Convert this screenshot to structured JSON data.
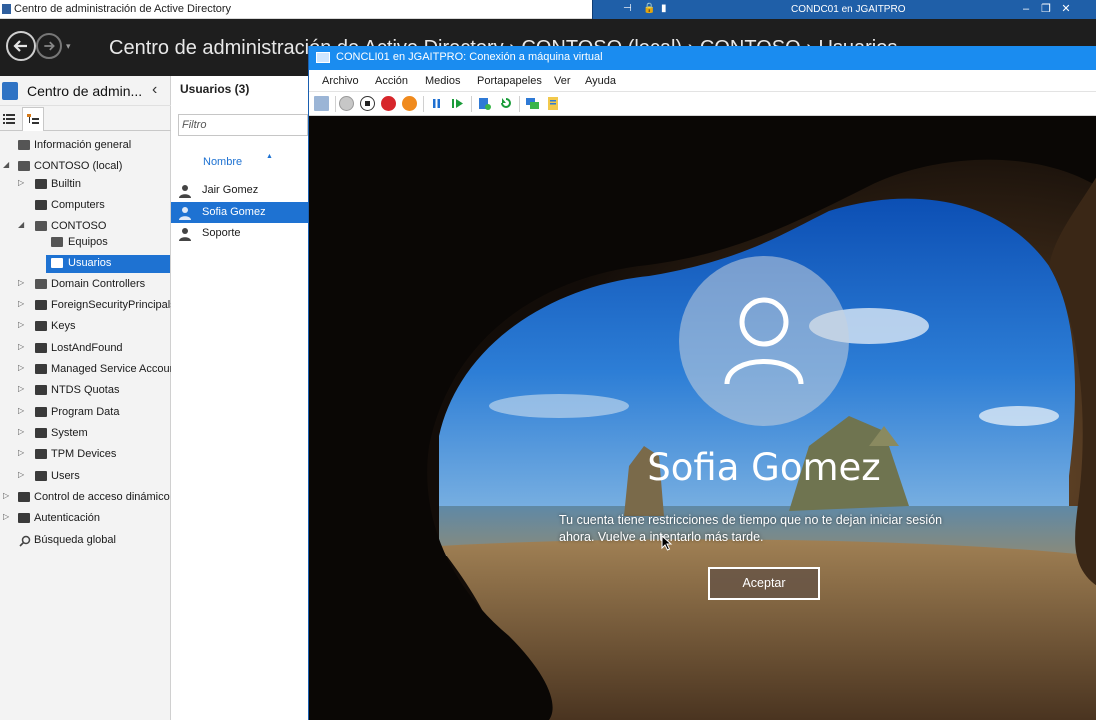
{
  "window": {
    "title": "Centro de administración de Active Directory"
  },
  "remote_bar": {
    "title": "CONDC01 en JGAITPRO"
  },
  "adac": {
    "title": "Centro de administración de Active Directory  ›  CONTOSO (local)  ›  CONTOSO  ›  Usuarios"
  },
  "nav": {
    "title": "Centro de admin...",
    "items": [
      {
        "label": "Información general"
      },
      {
        "label": "CONTOSO (local)"
      },
      {
        "label": "Builtin"
      },
      {
        "label": "Computers"
      },
      {
        "label": "CONTOSO"
      },
      {
        "label": "Equipos"
      },
      {
        "label": "Usuarios"
      },
      {
        "label": "Domain Controllers"
      },
      {
        "label": "ForeignSecurityPrincipals"
      },
      {
        "label": "Keys"
      },
      {
        "label": "LostAndFound"
      },
      {
        "label": "Managed Service Accoun"
      },
      {
        "label": "NTDS Quotas"
      },
      {
        "label": "Program Data"
      },
      {
        "label": "System"
      },
      {
        "label": "TPM Devices"
      },
      {
        "label": "Users"
      },
      {
        "label": "Control de acceso dinámico"
      },
      {
        "label": "Autenticación"
      },
      {
        "label": "Búsqueda global"
      }
    ]
  },
  "users_pane": {
    "header": "Usuarios  (3)",
    "filter_placeholder": "Filtro",
    "column": "Nombre",
    "rows": [
      "Jair Gomez",
      "Sofia Gomez",
      "Soporte"
    ]
  },
  "vm": {
    "title": "CONCLI01 en JGAITPRO: Conexión a máquina virtual",
    "menu": [
      "Archivo",
      "Acción",
      "Medios",
      "Portapapeles",
      "Ver",
      "Ayuda"
    ],
    "login": {
      "user": "Sofia Gomez",
      "message": "Tu cuenta tiene restricciones de tiempo que no te dejan iniciar sesión ahora. Vuelve a intentarlo más tarde.",
      "button": "Aceptar"
    }
  }
}
